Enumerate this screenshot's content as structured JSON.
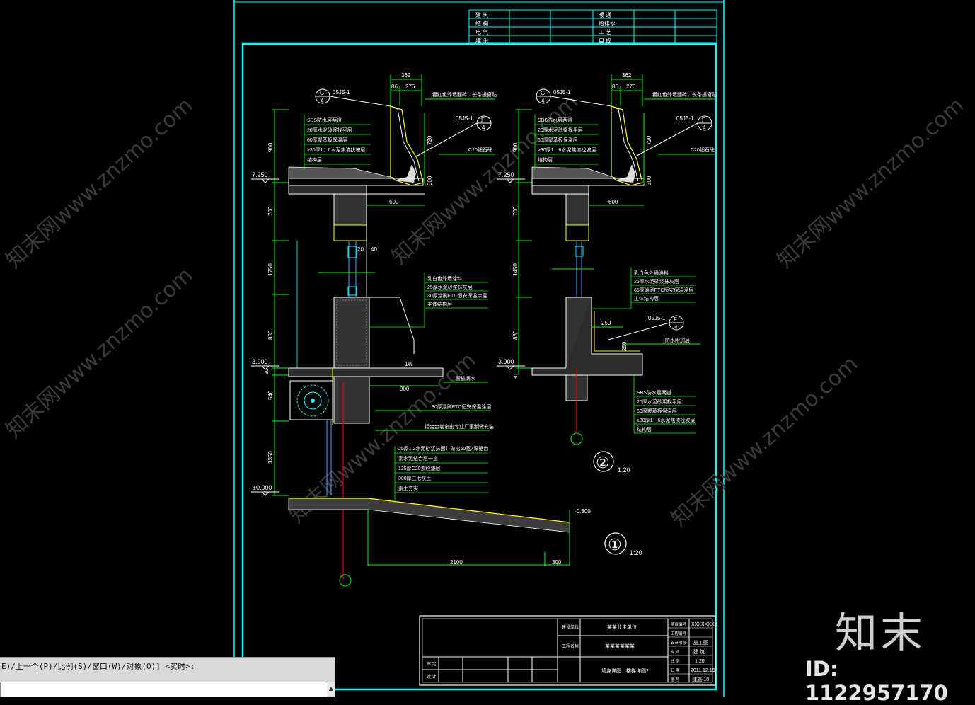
{
  "sheet_header": {
    "rows": [
      [
        "建 筑",
        "暖 通"
      ],
      [
        "结 构",
        "给排水"
      ],
      [
        "电 气",
        "工 艺"
      ],
      [
        "建 设",
        "自 控"
      ]
    ]
  },
  "detail1": {
    "label": "①",
    "scale": "1:20",
    "dims_top": [
      "362",
      "86",
      "276"
    ],
    "refs": [
      {
        "code": "05J5-1",
        "mark": "G/4"
      },
      {
        "code": "05J5-1",
        "mark": "F/4"
      }
    ],
    "notes_top": [
      "SBS防水层两道",
      "20厚水泥砂浆找平层",
      "60厚聚苯板保温层",
      "≥30厚1：6水泥焦渣找坡层",
      "结构层"
    ],
    "note_gutter": "镀红色外墙面砖，长条据窗贴",
    "note_c20": "C20细石砼",
    "elev_top": "7.250",
    "elev_mid": "3.900",
    "elev_zero": "±0.000",
    "elev_ground": "-0.300",
    "vert_dims": [
      "900",
      "720",
      "300",
      "700",
      "1750",
      "880",
      "30",
      "540",
      "3350"
    ],
    "dim_600": "600",
    "dim_20": "20",
    "dim_40": "40",
    "dim_900": "900",
    "slope": "1%",
    "wall_notes": [
      "乳白色外墙涂料",
      "25厚水泥砂浆抹灰层",
      "30厚涂刷FTC恒安保温涂层",
      "主体结构层"
    ],
    "note_drip": "腰檐滴水",
    "note_ftc": "30厚涂刷FTC恒安保温涂层",
    "note_shutter": "铝合金卷帘由专业厂家制做安装",
    "ramp_notes": [
      "25厚1:2水泥砂浆抹面并做出60宽7深锯齿",
      "素水泥结合层一道",
      "125厚C20素砼垫层",
      "300厚三七灰土",
      "素土夯实"
    ],
    "dim_2100": "2100",
    "dim_300": "300"
  },
  "detail2": {
    "label": "②",
    "scale": "1:20",
    "dims_top": [
      "362",
      "86",
      "276"
    ],
    "refs": [
      {
        "code": "05J5-1",
        "mark": "G/4"
      },
      {
        "code": "05J5-1",
        "mark": "F/4"
      },
      {
        "code": "05J5-1",
        "mark": "F/4"
      }
    ],
    "notes_top": [
      "SBS防水层两道",
      "20厚水泥砂浆找平层",
      "60厚聚苯板保温层",
      "≥30厚1：6水泥焦渣找坡层",
      "结构层"
    ],
    "note_gutter": "镀红色外墙面砖，长条据窗贴",
    "note_c20": "C20细石砼",
    "elev_top": "7.250",
    "elev_mid": "3.900",
    "vert_dims": [
      "900",
      "720",
      "300",
      "700",
      "1450",
      "880",
      "30"
    ],
    "dim_600": "600",
    "dim_250": "250",
    "wall_notes": [
      "乳白色外墙涂料",
      "25厚水泥砂浆抹灰层",
      "65厚涂刷FTC恒安保温涂层",
      "主体结构层"
    ],
    "note_waterproof": "防水附加层",
    "bottom_notes": [
      "SBS防水层两道",
      "20厚水泥砂浆找平层",
      "60厚聚苯板保温层",
      "≥30厚1：6水泥焦渣找坡层",
      "结构层"
    ]
  },
  "title_block": {
    "project_label": "建设单位",
    "project_name": "某某业主单位",
    "drawing_label": "工程名称",
    "drawing_name": "某某某某某某",
    "content": "墙身详图、楼梯详图2",
    "row_labels": [
      "审 定",
      "设 计"
    ],
    "right_labels": [
      "项目编号",
      "工程编号",
      "设计阶段",
      "专 业",
      "比 例",
      "日 期",
      "图 号"
    ],
    "right_values": [
      "XXXXXXXX",
      "",
      "施工图",
      "建 筑",
      "1:20",
      "2011.12.15",
      "建施-10"
    ]
  },
  "watermark": {
    "text": "知末网www.znzmo.com",
    "brand": "知末",
    "id": "ID: 1122957170"
  },
  "command_bar": {
    "prompt": "E)/上一个(P)/比例(S)/窗口(W)/对象(O)] <实时>:",
    "input_value": ""
  },
  "colors": {
    "background": "#000000",
    "frame": "#00ffff",
    "lines": "#00ff00",
    "white": "#ffffff",
    "yellow": "#ffff00",
    "red": "#ff0000",
    "blue": "#4aa3ff"
  }
}
